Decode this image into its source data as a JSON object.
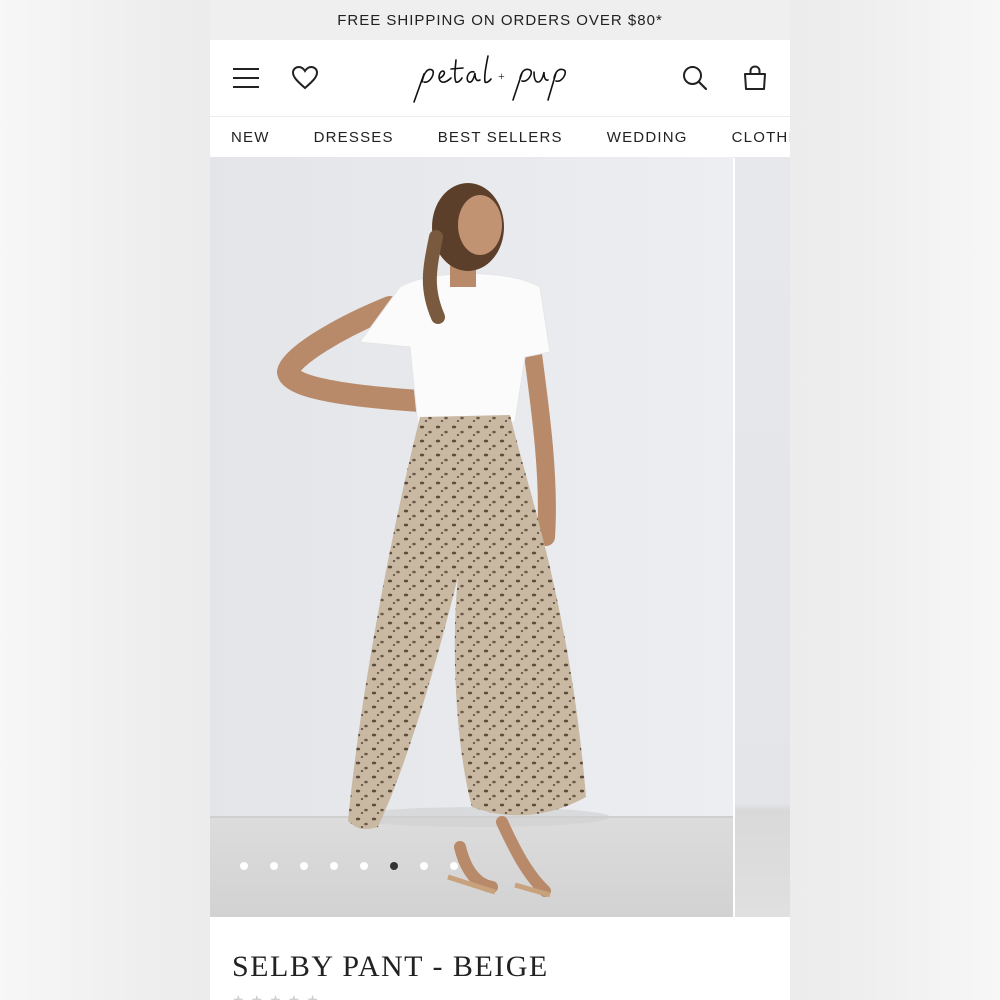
{
  "promo_banner": "FREE SHIPPING ON ORDERS OVER $80*",
  "header": {
    "menu_icon": "menu-icon",
    "wishlist_icon": "heart-icon",
    "logo_text": "petal + pup",
    "search_icon": "search-icon",
    "cart_icon": "bag-icon"
  },
  "nav": [
    "NEW",
    "DRESSES",
    "BEST SELLERS",
    "WEDDING",
    "CLOTHING"
  ],
  "carousel": {
    "total_slides": 8,
    "active_index": 5
  },
  "product": {
    "title": "SELBY PANT - BEIGE",
    "rating_stars": "★★★★★"
  },
  "colors": {
    "promo_bg": "#efefef",
    "text": "#222222",
    "dot_active": "#333333"
  }
}
